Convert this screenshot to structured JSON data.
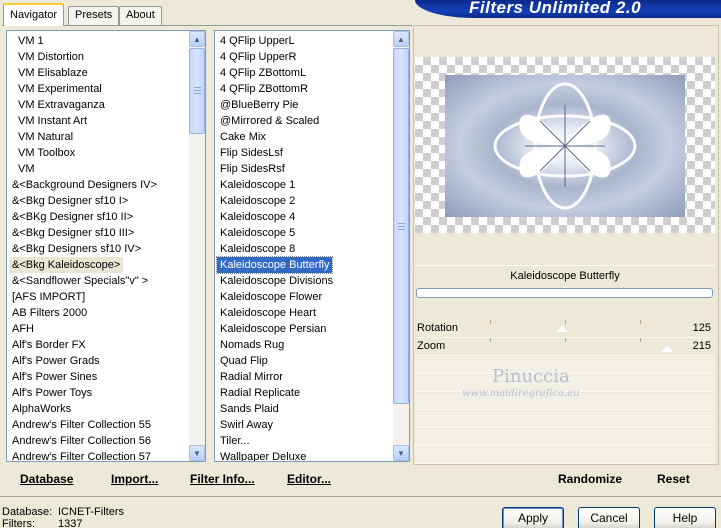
{
  "tabs": [
    {
      "label": "Navigator",
      "active": true
    },
    {
      "label": "Presets",
      "active": false
    },
    {
      "label": "About",
      "active": false
    }
  ],
  "banner_title": "Filters Unlimited 2.0",
  "categories": {
    "items": [
      "VM 1",
      "VM Distortion",
      "VM Elisablaze",
      "VM Experimental",
      "VM Extravaganza",
      "VM Instant Art",
      "VM Natural",
      "VM Toolbox",
      "VM",
      "&<Background Designers IV>",
      "&<Bkg Designer sf10 I>",
      "&<BKg Designer sf10 II>",
      "&<Bkg Designer sf10 III>",
      "&<Bkg Designers sf10 IV>",
      "&<Bkg Kaleidoscope>",
      "&<Sandflower Specials\"v\" >",
      "[AFS IMPORT]",
      "AB Filters 2000",
      "AFH",
      "Alf's Border FX",
      "Alf's Power Grads",
      "Alf's Power Sines",
      "Alf's Power Toys",
      "AlphaWorks",
      "Andrew's Filter Collection 55",
      "Andrew's Filter Collection 56",
      "Andrew's Filter Collection 57"
    ],
    "selected_index": 14
  },
  "filters": {
    "items": [
      "4 QFlip UpperL",
      "4 QFlip UpperR",
      "4 QFlip ZBottomL",
      "4 QFlip ZBottomR",
      "@BlueBerry Pie",
      "@Mirrored & Scaled",
      "Cake Mix",
      "Flip SidesLsf",
      "Flip SidesRsf",
      "Kaleidoscope 1",
      "Kaleidoscope 2",
      "Kaleidoscope 4",
      "Kaleidoscope 5",
      "Kaleidoscope 8",
      "Kaleidoscope Butterfly",
      "Kaleidoscope Divisions",
      "Kaleidoscope Flower",
      "Kaleidoscope Heart",
      "Kaleidoscope Persian",
      "Nomads Rug",
      "Quad Flip",
      "Radial Mirror",
      "Radial Replicate",
      "Sands Plaid",
      "Swirl Away",
      "Tiler...",
      "Wallpaper Deluxe"
    ],
    "selected_index": 14
  },
  "left_buttons": {
    "database": "Database",
    "import": "Import...",
    "filter_info": "Filter Info...",
    "editor": "Editor..."
  },
  "selected_filter_name": "Kaleidoscope Butterfly",
  "params": [
    {
      "label": "Rotation",
      "value": "125",
      "level": 0.49
    },
    {
      "label": "Zoom",
      "value": "215",
      "level": 0.84
    }
  ],
  "watermark": {
    "name": "Pinuccia",
    "url": "www.maidiregrafica.eu"
  },
  "right_buttons": {
    "randomize": "Randomize",
    "reset": "Reset"
  },
  "dialog_buttons": {
    "apply": "Apply",
    "cancel": "Cancel",
    "help": "Help"
  },
  "status": {
    "database_label": "Database:",
    "database_value": "ICNET-Filters",
    "filters_label": "Filters:",
    "filters_value": "1337"
  }
}
